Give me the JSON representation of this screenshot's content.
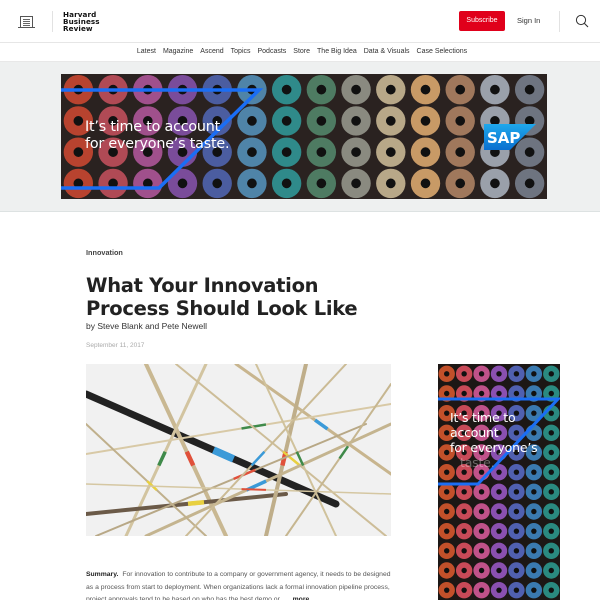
{
  "header": {
    "logo_lines": [
      "Harvard",
      "Business",
      "Review"
    ],
    "subscribe_label": "Subscribe",
    "signin_label": "Sign In",
    "icons": {
      "menu": "menu-icon",
      "search": "search-icon"
    },
    "brand_color": "#e0001b"
  },
  "nav": {
    "items": [
      "Latest",
      "Magazine",
      "Ascend",
      "Topics",
      "Podcasts",
      "Store",
      "The Big Idea",
      "Data & Visuals",
      "Case Selections"
    ]
  },
  "ads": {
    "top": {
      "headline_lines": [
        "It’s time to account",
        "for everyone’s taste."
      ],
      "brand": "SAP",
      "accent_color": "#1a6ef5"
    },
    "side": {
      "headline_lines": [
        "It’s time to account",
        "for everyone’s"
      ],
      "faded_line": "taste.",
      "accent_color": "#1a6ef5"
    }
  },
  "article": {
    "topic": "Innovation",
    "title": "What Your Innovation Process Should Look Like",
    "byline_prefix": "by ",
    "authors": [
      "Steve Blank",
      "Pete Newell"
    ],
    "byline_joiner": " and ",
    "date": "September 11, 2017",
    "hero_alt": "Scattered pick-up sticks",
    "summary_label": "Summary.",
    "summary_text": "For innovation to contribute to a company or government agency, it needs to be designed as a process from start to deployment. When organizations lack a formal innovation pipeline process, project approvals tend to be based on who has the best demo or…",
    "more_label": "more"
  }
}
